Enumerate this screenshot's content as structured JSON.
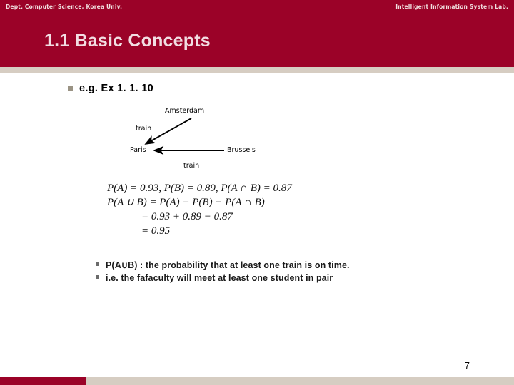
{
  "header": {
    "left_meta": "Dept. Computer Science, Korea Univ.",
    "right_meta": "Intelligent Information System Lab.",
    "title": "1.1 Basic Concepts"
  },
  "body": {
    "bullet": "e.g. Ex 1. 1. 10",
    "diagram": {
      "nodes": {
        "amsterdam": "Amsterdam",
        "paris": "Paris",
        "brussels": "Brussels"
      },
      "edge_labels": {
        "amsterdam_to_paris": "train",
        "brussels_to_paris": "train"
      }
    },
    "math": {
      "line1": "P(A) = 0.93,  P(B) = 0.89,  P(A ∩ B) = 0.87",
      "line2": "P(A ∪ B) = P(A) + P(B) − P(A ∩ B)",
      "line3": "= 0.93 + 0.89 − 0.87",
      "line4": "= 0.95"
    },
    "sub_bullets": [
      "P(A∪B) : the probability that at least one train is on time.",
      "i.e. the fafaculty will meet at least one student in pair"
    ]
  },
  "footer": {
    "page_number": "7"
  },
  "colors": {
    "brand_crimson": "#9b0228",
    "beige": "#d6cdc2",
    "title_text": "#f2dde2",
    "bullet_gray": "#9a9384"
  }
}
